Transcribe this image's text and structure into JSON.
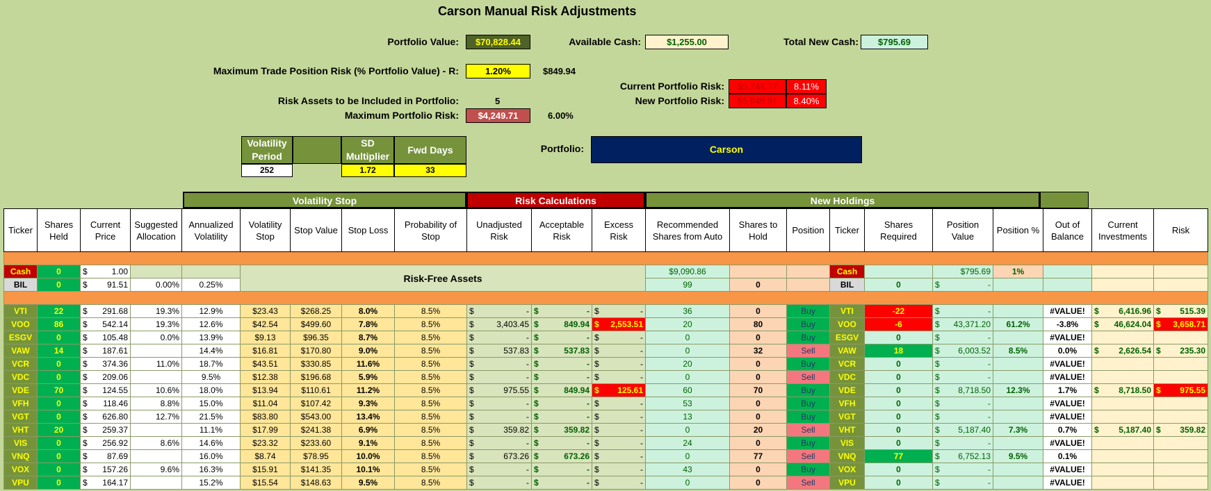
{
  "title": "Carson Manual Risk Adjustments",
  "summary": {
    "portfolio_value_label": "Portfolio Value:",
    "portfolio_value": "$70,828.44",
    "available_cash_label": "Available Cash:",
    "available_cash": "$1,255.00",
    "total_new_cash_label": "Total New Cash:",
    "total_new_cash": "$795.69",
    "max_trade_risk_label": "Maximum Trade Position Risk (% Portfolio Value) - R:",
    "max_trade_risk_pct": "1.20%",
    "max_trade_risk_amt": "$849.94",
    "current_risk_label": "Current Portfolio Risk:",
    "current_risk_amt": "$5,744.77",
    "current_risk_pct": "8.11%",
    "new_risk_label": "New Portfolio Risk:",
    "new_risk_amt": "$5,949.91",
    "new_risk_pct": "8.40%",
    "risk_assets_label": "Risk Assets to be Included in Portfolio:",
    "risk_assets": "5",
    "max_portfolio_risk_label": "Maximum Portfolio Risk:",
    "max_portfolio_risk": "$4,249.71",
    "max_portfolio_risk_pct": "6.00%",
    "portfolio_label": "Portfolio:",
    "portfolio_name": "Carson"
  },
  "params": {
    "vol_period_header": "Volatility Period",
    "sd_mult_header": "SD Multiplier",
    "fwd_days_header": "Fwd Days",
    "vol_period": "252",
    "sd_mult": "1.72",
    "fwd_days": "33"
  },
  "groups": {
    "vol_stop": "Volatility Stop",
    "risk_calc": "Risk Calculations",
    "new_holdings": "New Holdings"
  },
  "headers": [
    "Ticker",
    "Shares Held",
    "Current Price",
    "Suggested Allocation",
    "Annualized Volatility",
    "Volatility Stop",
    "Stop Value",
    "Stop Loss",
    "Probability of Stop",
    "Unadjusted Risk",
    "Acceptable Risk",
    "Excess Risk",
    "Recommended Shares from Auto",
    "Shares to Hold",
    "Position",
    "Ticker",
    "Shares Required",
    "Position Value",
    "Position %",
    "Out of Balance",
    "Current Investments",
    "Risk"
  ],
  "cash_row": {
    "ticker": "Cash",
    "shares": "0",
    "price": "1.00",
    "rec": "$9,090.86",
    "ticker2": "Cash",
    "posval": "$795.69",
    "pospct": "1%"
  },
  "bil_row": {
    "ticker": "BIL",
    "shares": "0",
    "price": "91.51",
    "alloc": "0.00%",
    "vol": "0.25%",
    "rec": "99",
    "hold": "0",
    "ticker2": "BIL",
    "req": "0",
    "posval": "-"
  },
  "risk_free_label": "Risk-Free Assets",
  "rows": [
    {
      "t": "VTI",
      "sh": "22",
      "pr": "291.68",
      "al": "19.3%",
      "av": "12.9%",
      "vs": "$23.43",
      "sv": "$268.25",
      "sl": "8.0%",
      "ps": "8.5%",
      "ur": "-",
      "ar": "-",
      "er": "-",
      "erRed": false,
      "rec": "36",
      "hold": "0",
      "pos": "Buy",
      "req": "-22",
      "reqC": "red",
      "pv": "-",
      "pp": "",
      "ob": "#VALUE!",
      "ci": "6,416.96",
      "rk": "515.39",
      "rkRed": false
    },
    {
      "t": "VOO",
      "sh": "86",
      "pr": "542.14",
      "al": "19.3%",
      "av": "12.6%",
      "vs": "$42.54",
      "sv": "$499.60",
      "sl": "7.8%",
      "ps": "8.5%",
      "ur": "3,403.45",
      "ar": "849.94",
      "er": "2,553.51",
      "erRed": true,
      "rec": "20",
      "hold": "80",
      "pos": "Buy",
      "req": "-6",
      "reqC": "red",
      "pv": "43,371.20",
      "pp": "61.2%",
      "ob": "-3.8%",
      "ci": "46,624.04",
      "rk": "3,658.71",
      "rkRed": true
    },
    {
      "t": "ESGV",
      "sh": "0",
      "pr": "105.48",
      "al": "0.0%",
      "av": "13.9%",
      "vs": "$9.13",
      "sv": "$96.35",
      "sl": "8.7%",
      "ps": "8.5%",
      "ur": "-",
      "ar": "-",
      "er": "-",
      "erRed": false,
      "rec": "0",
      "hold": "0",
      "pos": "Buy",
      "req": "0",
      "reqC": "",
      "pv": "-",
      "pp": "",
      "ob": "#VALUE!",
      "ci": "",
      "rk": "",
      "rkRed": false
    },
    {
      "t": "VAW",
      "sh": "14",
      "pr": "187.61",
      "al": "",
      "av": "14.4%",
      "vs": "$16.81",
      "sv": "$170.80",
      "sl": "9.0%",
      "ps": "8.5%",
      "ur": "537.83",
      "ar": "537.83",
      "er": "-",
      "erRed": false,
      "rec": "0",
      "hold": "32",
      "pos": "Sell",
      "req": "18",
      "reqC": "grn",
      "pv": "6,003.52",
      "pp": "8.5%",
      "ob": "0.0%",
      "ci": "2,626.54",
      "rk": "235.30",
      "rkRed": false
    },
    {
      "t": "VCR",
      "sh": "0",
      "pr": "374.36",
      "al": "11.0%",
      "av": "18.7%",
      "vs": "$43.51",
      "sv": "$330.85",
      "sl": "11.6%",
      "ps": "8.5%",
      "ur": "-",
      "ar": "-",
      "er": "-",
      "erRed": false,
      "rec": "20",
      "hold": "0",
      "pos": "Buy",
      "req": "0",
      "reqC": "",
      "pv": "-",
      "pp": "",
      "ob": "#VALUE!",
      "ci": "",
      "rk": "",
      "rkRed": false
    },
    {
      "t": "VDC",
      "sh": "0",
      "pr": "209.06",
      "al": "",
      "av": "9.5%",
      "vs": "$12.38",
      "sv": "$196.68",
      "sl": "5.9%",
      "ps": "8.5%",
      "ur": "-",
      "ar": "-",
      "er": "-",
      "erRed": false,
      "rec": "0",
      "hold": "0",
      "pos": "Sell",
      "req": "0",
      "reqC": "",
      "pv": "-",
      "pp": "",
      "ob": "#VALUE!",
      "ci": "",
      "rk": "",
      "rkRed": false
    },
    {
      "t": "VDE",
      "sh": "70",
      "pr": "124.55",
      "al": "10.6%",
      "av": "18.0%",
      "vs": "$13.94",
      "sv": "$110.61",
      "sl": "11.2%",
      "ps": "8.5%",
      "ur": "975.55",
      "ar": "849.94",
      "er": "125.61",
      "erRed": true,
      "rec": "60",
      "hold": "70",
      "pos": "Buy",
      "req": "0",
      "reqC": "",
      "pv": "8,718.50",
      "pp": "12.3%",
      "ob": "1.7%",
      "ci": "8,718.50",
      "rk": "975.55",
      "rkRed": true
    },
    {
      "t": "VFH",
      "sh": "0",
      "pr": "118.46",
      "al": "8.8%",
      "av": "15.0%",
      "vs": "$11.04",
      "sv": "$107.42",
      "sl": "9.3%",
      "ps": "8.5%",
      "ur": "-",
      "ar": "-",
      "er": "-",
      "erRed": false,
      "rec": "53",
      "hold": "0",
      "pos": "Buy",
      "req": "0",
      "reqC": "",
      "pv": "-",
      "pp": "",
      "ob": "#VALUE!",
      "ci": "",
      "rk": "",
      "rkRed": false
    },
    {
      "t": "VGT",
      "sh": "0",
      "pr": "626.80",
      "al": "12.7%",
      "av": "21.5%",
      "vs": "$83.80",
      "sv": "$543.00",
      "sl": "13.4%",
      "ps": "8.5%",
      "ur": "-",
      "ar": "-",
      "er": "-",
      "erRed": false,
      "rec": "13",
      "hold": "0",
      "pos": "Buy",
      "req": "0",
      "reqC": "",
      "pv": "-",
      "pp": "",
      "ob": "#VALUE!",
      "ci": "",
      "rk": "",
      "rkRed": false
    },
    {
      "t": "VHT",
      "sh": "20",
      "pr": "259.37",
      "al": "",
      "av": "11.1%",
      "vs": "$17.99",
      "sv": "$241.38",
      "sl": "6.9%",
      "ps": "8.5%",
      "ur": "359.82",
      "ar": "359.82",
      "er": "-",
      "erRed": false,
      "rec": "0",
      "hold": "20",
      "pos": "Sell",
      "req": "0",
      "reqC": "",
      "pv": "5,187.40",
      "pp": "7.3%",
      "ob": "0.7%",
      "ci": "5,187.40",
      "rk": "359.82",
      "rkRed": false
    },
    {
      "t": "VIS",
      "sh": "0",
      "pr": "256.92",
      "al": "8.6%",
      "av": "14.6%",
      "vs": "$23.32",
      "sv": "$233.60",
      "sl": "9.1%",
      "ps": "8.5%",
      "ur": "-",
      "ar": "-",
      "er": "-",
      "erRed": false,
      "rec": "24",
      "hold": "0",
      "pos": "Buy",
      "req": "0",
      "reqC": "",
      "pv": "-",
      "pp": "",
      "ob": "#VALUE!",
      "ci": "",
      "rk": "",
      "rkRed": false
    },
    {
      "t": "VNQ",
      "sh": "0",
      "pr": "87.69",
      "al": "",
      "av": "16.0%",
      "vs": "$8.74",
      "sv": "$78.95",
      "sl": "10.0%",
      "ps": "8.5%",
      "ur": "673.26",
      "ar": "673.26",
      "er": "-",
      "erRed": false,
      "rec": "0",
      "hold": "77",
      "pos": "Sell",
      "req": "77",
      "reqC": "grn",
      "pv": "6,752.13",
      "pp": "9.5%",
      "ob": "0.1%",
      "ci": "",
      "rk": "",
      "rkRed": false
    },
    {
      "t": "VOX",
      "sh": "0",
      "pr": "157.26",
      "al": "9.6%",
      "av": "16.3%",
      "vs": "$15.91",
      "sv": "$141.35",
      "sl": "10.1%",
      "ps": "8.5%",
      "ur": "-",
      "ar": "-",
      "er": "-",
      "erRed": false,
      "rec": "43",
      "hold": "0",
      "pos": "Buy",
      "req": "0",
      "reqC": "",
      "pv": "-",
      "pp": "",
      "ob": "#VALUE!",
      "ci": "",
      "rk": "",
      "rkRed": false
    },
    {
      "t": "VPU",
      "sh": "0",
      "pr": "164.17",
      "al": "",
      "av": "15.2%",
      "vs": "$15.54",
      "sv": "$148.63",
      "sl": "9.5%",
      "ps": "8.5%",
      "ur": "-",
      "ar": "-",
      "er": "-",
      "erRed": false,
      "rec": "0",
      "hold": "0",
      "pos": "Sell",
      "req": "0",
      "reqC": "",
      "pv": "-",
      "pp": "",
      "ob": "#VALUE!",
      "ci": "",
      "rk": "",
      "rkRed": false
    }
  ]
}
